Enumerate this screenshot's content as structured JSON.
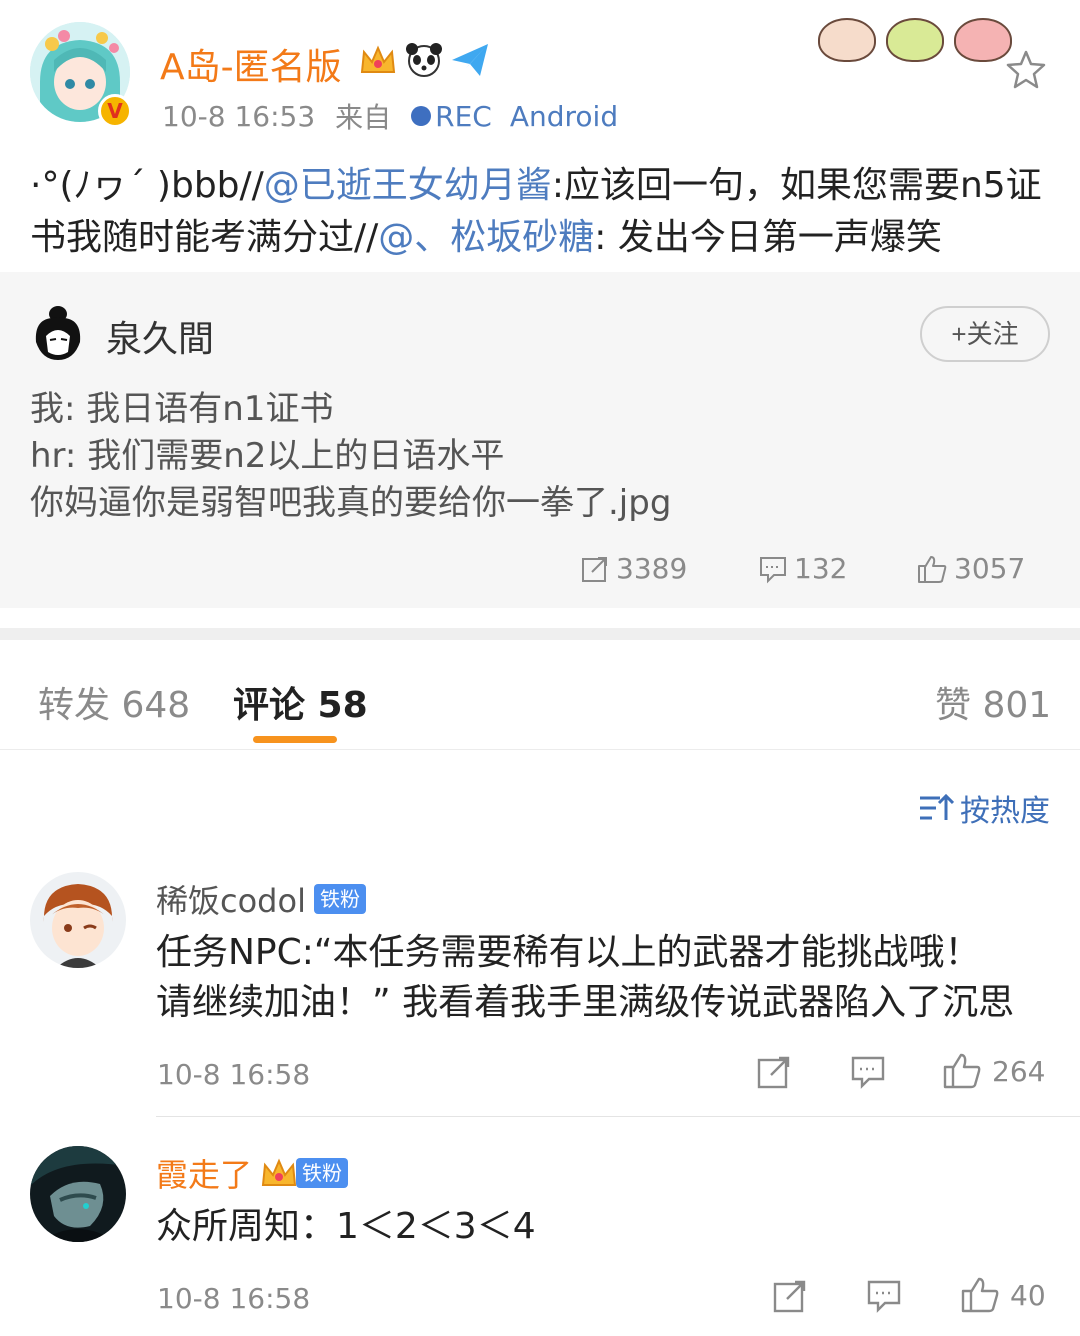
{
  "post": {
    "author": "A岛-匿名版",
    "time": "10-8 16:53",
    "source_prefix": "来自",
    "source_tag": "REC",
    "source_app": "Android",
    "text_parts": [
      {
        "t": "·°(ﾉヮ´ )bbb//",
        "mention": false
      },
      {
        "t": "@已逝王女幼月酱",
        "mention": true
      },
      {
        "t": ":应该回一句，如果您需要n5证书我随时能考满分过//",
        "mention": false
      },
      {
        "t": "@、松坂砂糖",
        "mention": true
      },
      {
        "t": ": 发出今日第一声爆笑",
        "mention": false
      }
    ]
  },
  "repost": {
    "author": "泉久間",
    "follow_label": "+关注",
    "lines": [
      "我: 我日语有n1证书",
      "hr: 我们需要n2以上的日语水平",
      "你妈逼你是弱智吧我真的要给你一拳了.jpg"
    ],
    "reposts": "3389",
    "comments": "132",
    "likes": "3057"
  },
  "tabs": {
    "repost_label": "转发 648",
    "comment_label": "评论 58",
    "like_label": "赞 801"
  },
  "sort": {
    "label": "按热度"
  },
  "comments": [
    {
      "name": "稀饭codol",
      "badge": "铁粉",
      "text_line1": "任务NPC:“本任务需要稀有以上的武器才能挑战哦！",
      "text_line2": "请继续加油！” 我看着我手里满级传说武器陷入了沉思",
      "time": "10-8 16:58",
      "likes": "264"
    },
    {
      "name": "霞走了",
      "badge": "铁粉",
      "text_line1": "众所周知：1＜2＜3＜4",
      "time": "10-8 16:58",
      "likes": "40"
    }
  ],
  "colors": {
    "accent": "#f7931e",
    "link": "#4e7cbf",
    "name_vip": "#f37a18",
    "badge": "#4c8ff0"
  }
}
